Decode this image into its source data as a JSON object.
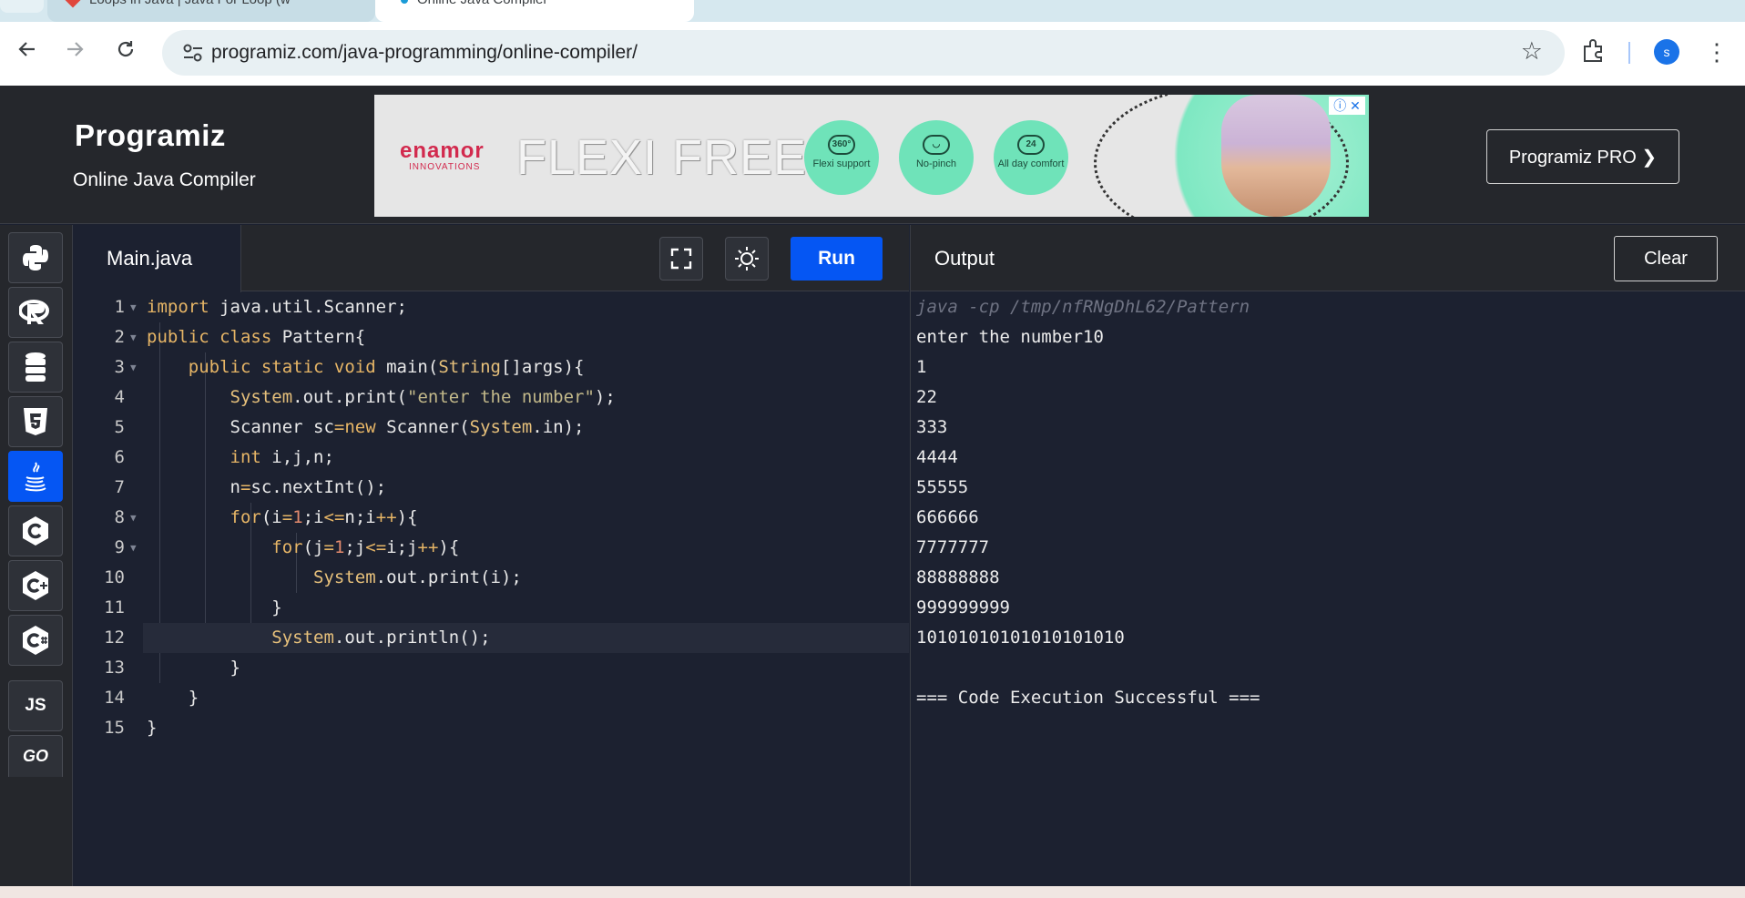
{
  "browser": {
    "tabs": [
      {
        "title": "Loops in Java | Java For Loop (w"
      },
      {
        "title": "Online Java Compiler"
      }
    ],
    "url": "programiz.com/java-programming/online-compiler/",
    "profile_initial": "s"
  },
  "site": {
    "logo": "Programiz",
    "subtitle": "Online Java Compiler",
    "pro_button": "Programiz PRO ❯"
  },
  "ad": {
    "brand": "enamor",
    "brand_sub": "INNOVATIONS",
    "headline": "FLEXI FREE",
    "badges": [
      {
        "icon": "360°",
        "label": "Flexi support"
      },
      {
        "icon": "◡",
        "label": "No-pinch"
      },
      {
        "icon": "24",
        "label": "All day comfort"
      }
    ],
    "info": "ⓘ ✕"
  },
  "languages": [
    {
      "name": "python-icon",
      "glyph": "🐍"
    },
    {
      "name": "r-icon",
      "glyph": "R"
    },
    {
      "name": "sql-icon",
      "glyph": "☰"
    },
    {
      "name": "html5-icon",
      "glyph": "5"
    },
    {
      "name": "java-icon",
      "glyph": "☕",
      "active": true
    },
    {
      "name": "c-icon",
      "glyph": "C"
    },
    {
      "name": "cpp-icon",
      "glyph": "C+"
    },
    {
      "name": "csharp-icon",
      "glyph": "C#"
    },
    {
      "name": "javascript-icon",
      "glyph": "JS"
    },
    {
      "name": "go-icon",
      "glyph": "GO"
    }
  ],
  "editor": {
    "file_name": "Main.java",
    "run_label": "Run",
    "code_lines": [
      "import java.util.Scanner;",
      "public class Pattern{",
      "    public static void main(String[]args){",
      "        System.out.print(\"enter the number\");",
      "        Scanner sc=new Scanner(System.in);",
      "        int i,j,n;",
      "        n=sc.nextInt();",
      "        for(i=1;i<=n;i++){",
      "            for(j=1;j<=i;j++){",
      "                System.out.print(i);",
      "            }",
      "            System.out.println();",
      "        }",
      "    }",
      "}"
    ]
  },
  "output": {
    "title": "Output",
    "clear_label": "Clear",
    "command": "java -cp /tmp/nfRNgDhL62/Pattern",
    "lines": [
      "enter the number10",
      "1",
      "22",
      "333",
      "4444",
      "55555",
      "666666",
      "7777777",
      "88888888",
      "999999999",
      "10101010101010101010",
      "",
      "=== Code Execution Successful ==="
    ]
  }
}
